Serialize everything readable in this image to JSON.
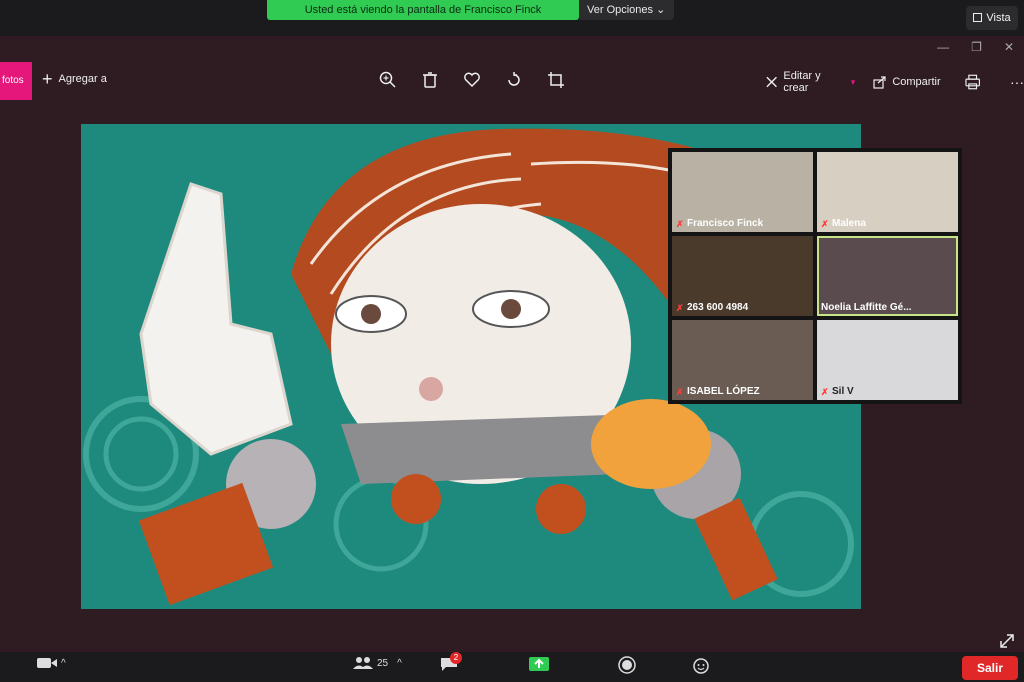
{
  "zoom": {
    "share_banner": "Usted está viendo la pantalla de Francisco Finck",
    "view_options": "Ver Opciones",
    "vista": "Vista",
    "participants_count": "25",
    "chat_badge": "2",
    "exit_label": "Salir"
  },
  "photos": {
    "tab_label": "fotos",
    "add_to": "Agregar a",
    "edit_create": "Editar y crear",
    "share": "Compartir"
  },
  "gallery": [
    {
      "name": "Francisco Finck",
      "bg": "#b9b2a4"
    },
    {
      "name": "Malena",
      "bg": "#d8cfc3"
    },
    {
      "name": "263 600 4984",
      "bg": "#4a3a2c"
    },
    {
      "name": "Noelia Laffitte Gé...",
      "bg": "#5a4b4e"
    },
    {
      "name": "ISABEL LÓPEZ",
      "bg": "#6a5c52"
    },
    {
      "name": "Sil V",
      "bg": "#d9d9db"
    }
  ],
  "colors": {
    "accent_pink": "#e5177b",
    "share_green": "#2fcb52",
    "exit_red": "#e02828",
    "art_teal": "#1e8a7d"
  }
}
